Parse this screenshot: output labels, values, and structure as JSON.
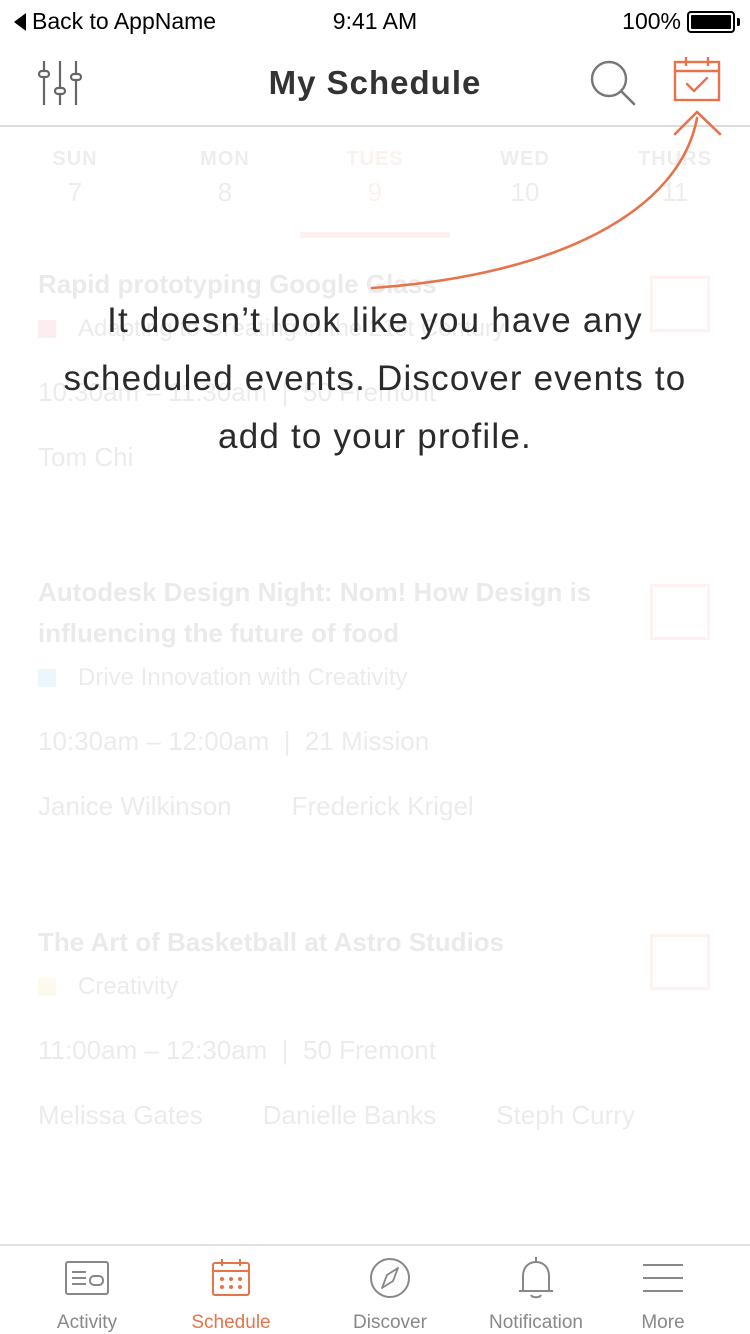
{
  "status_bar": {
    "back_label": "Back to AppName",
    "time": "9:41 AM",
    "battery": "100%"
  },
  "nav": {
    "title": "My Schedule"
  },
  "days": [
    {
      "name": "SUN",
      "date": "7"
    },
    {
      "name": "MON",
      "date": "8"
    },
    {
      "name": "TUES",
      "date": "9"
    },
    {
      "name": "WED",
      "date": "10"
    },
    {
      "name": "THURS",
      "date": "11"
    }
  ],
  "events": [
    {
      "title": "Rapid prototyping Google Glass",
      "track": "Adapting to Creating in the 21st Century",
      "track_color": "#e8436a",
      "time_place": "10:30am – 11:30am  |  50 Fremont",
      "people": [
        "Tom Chi"
      ]
    },
    {
      "title": "Autodesk Design Night: Nom! How Design is influencing the future of food",
      "track": "Drive Innovation with Creativity",
      "track_color": "#3bb3e0",
      "time_place": "10:30am – 12:00am  |  21 Mission",
      "people": [
        "Janice Wilkinson",
        "Frederick Krigel"
      ]
    },
    {
      "title": "The Art of Basketball at Astro Studios",
      "track": "Creativity",
      "track_color": "#d8d33a",
      "time_place": "11:00am – 12:30am  |  50 Fremont",
      "people": [
        "Melissa Gates",
        "Danielle Banks",
        "Steph Curry"
      ]
    }
  ],
  "empty_message": "It doesn’t look like you have any scheduled events. Discover events to add to your profile.",
  "tabs": [
    {
      "label": "Activity",
      "icon": "activity-icon"
    },
    {
      "label": "Schedule",
      "icon": "calendar-icon"
    },
    {
      "label": "Discover",
      "icon": "compass-icon"
    },
    {
      "label": "Notification",
      "icon": "bell-icon"
    },
    {
      "label": "More",
      "icon": "menu-icon"
    }
  ],
  "colors": {
    "accent": "#e8734a",
    "tab_inactive": "#888888"
  }
}
